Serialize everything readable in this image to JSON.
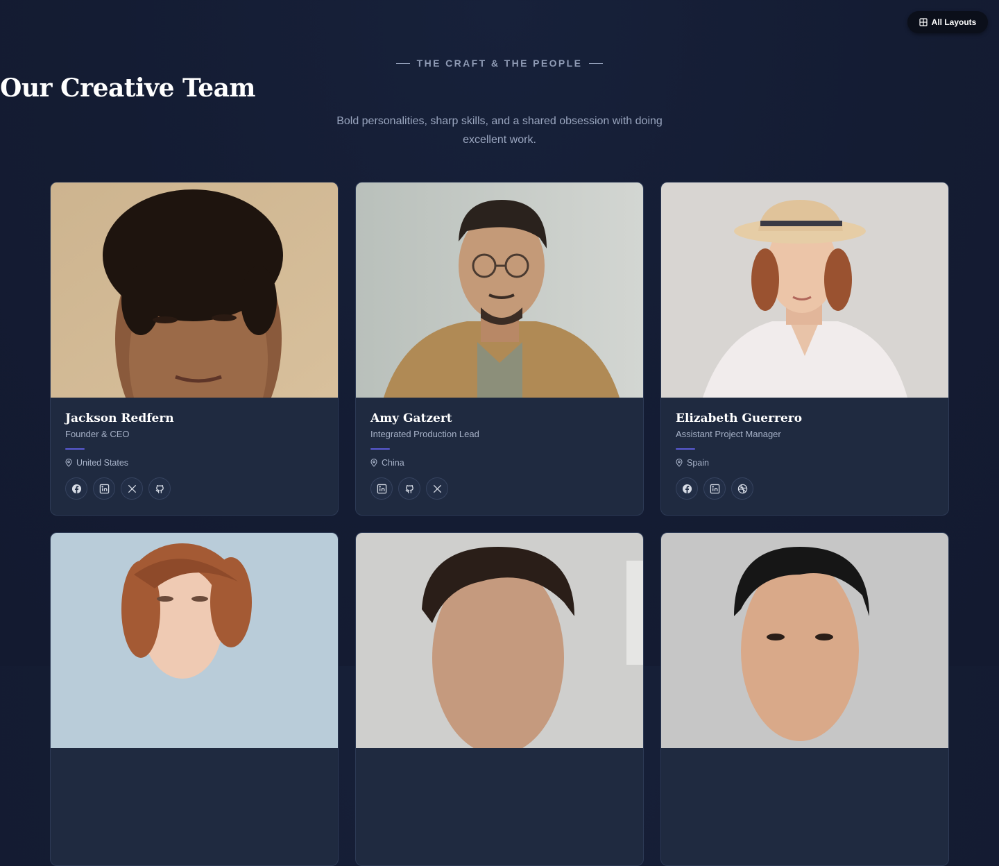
{
  "nav": {
    "all_layouts": "All Layouts"
  },
  "header": {
    "eyebrow": "THE CRAFT & THE PEOPLE",
    "title": "Our Creative Team",
    "subtitle": "Bold personalities, sharp skills, and a shared obsession with doing excellent work."
  },
  "team": [
    {
      "name": "Jackson Redfern",
      "role": "Founder & CEO",
      "location": "United States",
      "socials": [
        "facebook-icon",
        "linkedin-icon",
        "x-icon",
        "github-icon"
      ]
    },
    {
      "name": "Amy Gatzert",
      "role": "Integrated Production Lead",
      "location": "China",
      "socials": [
        "linkedin-icon",
        "github-icon",
        "x-icon"
      ]
    },
    {
      "name": "Elizabeth Guerrero",
      "role": "Assistant Project Manager",
      "location": "Spain",
      "socials": [
        "facebook-icon",
        "linkedin-icon",
        "dribbble-icon"
      ]
    }
  ],
  "colors": {
    "background": "#141c33",
    "card": "#1f2a40",
    "accent": "#5b5bd6"
  }
}
